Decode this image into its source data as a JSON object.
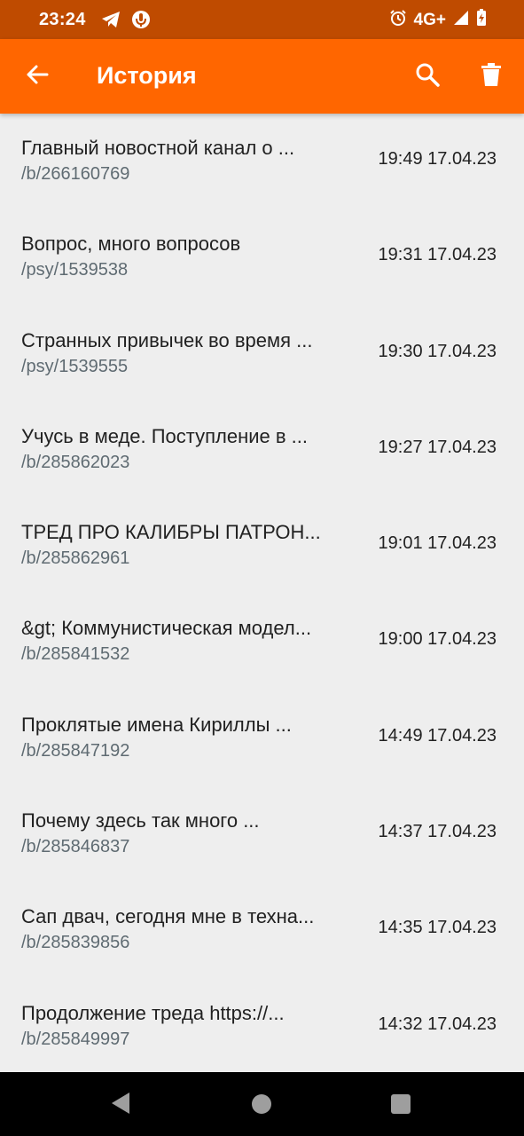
{
  "status_bar": {
    "time": "23:24",
    "network": "4G+",
    "left_icons": [
      "telegram-icon",
      "notification-app-icon"
    ],
    "right_icons": [
      "alarm-icon",
      "signal-icon",
      "battery-icon"
    ]
  },
  "app_bar": {
    "title": "История",
    "color": "#ff6600",
    "actions": [
      "back-arrow-icon",
      "search-icon",
      "trash-icon"
    ]
  },
  "history": [
    {
      "title": "Главный новостной канал о ...",
      "path": "/b/266160769",
      "time": "19:49 17.04.23"
    },
    {
      "title": "Вопрос, много вопросов",
      "path": "/psy/1539538",
      "time": "19:31 17.04.23"
    },
    {
      "title": "Странных привычек во время ...",
      "path": "/psy/1539555",
      "time": "19:30 17.04.23"
    },
    {
      "title": "Учусь в меде. Поступление в ...",
      "path": "/b/285862023",
      "time": "19:27 17.04.23"
    },
    {
      "title": "ТРЕД ПРО КАЛИБРЫ ПАТРОН...",
      "path": "/b/285862961",
      "time": "19:01 17.04.23"
    },
    {
      "title": "&gt; Коммунистическая модел...",
      "path": "/b/285841532",
      "time": "19:00 17.04.23"
    },
    {
      "title": "Проклятые имена Кириллы  ...",
      "path": "/b/285847192",
      "time": "14:49 17.04.23"
    },
    {
      "title": "Почему здесь так много ...",
      "path": "/b/285846837",
      "time": "14:37 17.04.23"
    },
    {
      "title": "Сап двач, сегодня мне в техна...",
      "path": "/b/285839856",
      "time": "14:35 17.04.23"
    },
    {
      "title": "Продолжение треда https://...",
      "path": "/b/285849997",
      "time": "14:32 17.04.23"
    }
  ],
  "nav_bar": {
    "buttons": [
      "nav-back-icon",
      "nav-home-icon",
      "nav-recents-icon"
    ]
  }
}
